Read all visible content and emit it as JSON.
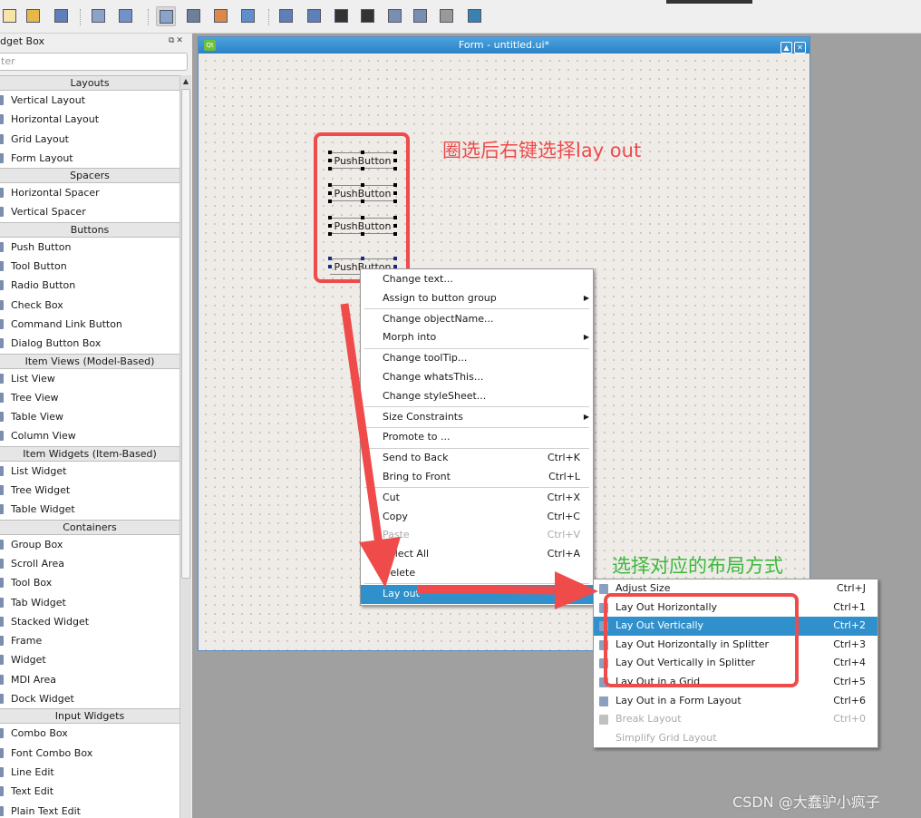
{
  "toolbar": {
    "icons": [
      "new-file-icon",
      "open-folder-icon",
      "save-icon",
      "send-to-back-icon",
      "bring-to-front-icon",
      "edit-widgets-icon",
      "edit-signals-slots-icon",
      "edit-buddies-icon",
      "edit-tab-order-icon",
      "layout-horizontal-icon",
      "layout-vertical-icon",
      "layout-h-splitter-icon",
      "layout-v-splitter-icon",
      "layout-grid-icon",
      "layout-form-icon",
      "break-layout-icon",
      "adjust-size-icon"
    ]
  },
  "widget_box": {
    "title": "dget Box",
    "filter_placeholder": "ter",
    "sections": [
      {
        "title": "Layouts",
        "items": [
          "Vertical Layout",
          "Horizontal Layout",
          "Grid Layout",
          "Form Layout"
        ]
      },
      {
        "title": "Spacers",
        "items": [
          "Horizontal Spacer",
          "Vertical Spacer"
        ]
      },
      {
        "title": "Buttons",
        "items": [
          "Push Button",
          "Tool Button",
          "Radio Button",
          "Check Box",
          "Command Link Button",
          "Dialog Button Box"
        ]
      },
      {
        "title": "Item Views (Model-Based)",
        "items": [
          "List View",
          "Tree View",
          "Table View",
          "Column View"
        ]
      },
      {
        "title": "Item Widgets (Item-Based)",
        "items": [
          "List Widget",
          "Tree Widget",
          "Table Widget"
        ]
      },
      {
        "title": "Containers",
        "items": [
          "Group Box",
          "Scroll Area",
          "Tool Box",
          "Tab Widget",
          "Stacked Widget",
          "Frame",
          "Widget",
          "MDI Area",
          "Dock Widget"
        ]
      },
      {
        "title": "Input Widgets",
        "items": [
          "Combo Box",
          "Font Combo Box",
          "Line Edit",
          "Text Edit",
          "Plain Text Edit"
        ]
      }
    ]
  },
  "form": {
    "title": "Form - untitled.ui*",
    "buttons": [
      "PushButton",
      "PushButton",
      "PushButton",
      "PushButton"
    ]
  },
  "context_menu": [
    {
      "label": "Change text..."
    },
    {
      "label": "Assign to button group",
      "submenu": true,
      "sep": true
    },
    {
      "label": "Change objectName..."
    },
    {
      "label": "Morph into",
      "submenu": true,
      "sep": true
    },
    {
      "label": "Change toolTip..."
    },
    {
      "label": "Change whatsThis..."
    },
    {
      "label": "Change styleSheet...",
      "sep": true
    },
    {
      "label": "Size Constraints",
      "submenu": true,
      "sep": true
    },
    {
      "label": "Promote to ...",
      "sep": true
    },
    {
      "label": "Send to Back",
      "shortcut": "Ctrl+K"
    },
    {
      "label": "Bring to Front",
      "shortcut": "Ctrl+L",
      "sep": true
    },
    {
      "label": "Cut",
      "shortcut": "Ctrl+X"
    },
    {
      "label": "Copy",
      "shortcut": "Ctrl+C"
    },
    {
      "label": "Paste",
      "shortcut": "Ctrl+V",
      "disabled": true
    },
    {
      "label": "Select All",
      "shortcut": "Ctrl+A"
    },
    {
      "label": "Delete",
      "sep": true
    },
    {
      "label": "Lay out",
      "highlighted": true
    }
  ],
  "layout_submenu": [
    {
      "label": "Adjust Size",
      "shortcut": "Ctrl+J",
      "icon": "adjust-size-icon"
    },
    {
      "label": "Lay Out Horizontally",
      "shortcut": "Ctrl+1",
      "icon": "layout-horizontal-icon"
    },
    {
      "label": "Lay Out Vertically",
      "shortcut": "Ctrl+2",
      "icon": "layout-vertical-icon",
      "highlighted": true
    },
    {
      "label": "Lay Out Horizontally in Splitter",
      "shortcut": "Ctrl+3",
      "icon": "layout-h-splitter-icon"
    },
    {
      "label": "Lay Out Vertically in Splitter",
      "shortcut": "Ctrl+4",
      "icon": "layout-v-splitter-icon"
    },
    {
      "label": "Lay Out in a Grid",
      "shortcut": "Ctrl+5",
      "icon": "layout-grid-icon"
    },
    {
      "label": "Lay Out in a Form Layout",
      "shortcut": "Ctrl+6",
      "icon": "layout-form-icon"
    },
    {
      "label": "Break Layout",
      "shortcut": "Ctrl+0",
      "icon": "break-layout-icon",
      "disabled": true
    },
    {
      "label": "Simplify Grid Layout",
      "disabled": true
    }
  ],
  "annotations": {
    "note1": "圈选后右键选择lay out",
    "note2": "选择对应的布局方式",
    "color_red": "#ef4b4b",
    "color_green": "#3cb83c"
  },
  "watermark": "CSDN @大蠢驴小疯子"
}
